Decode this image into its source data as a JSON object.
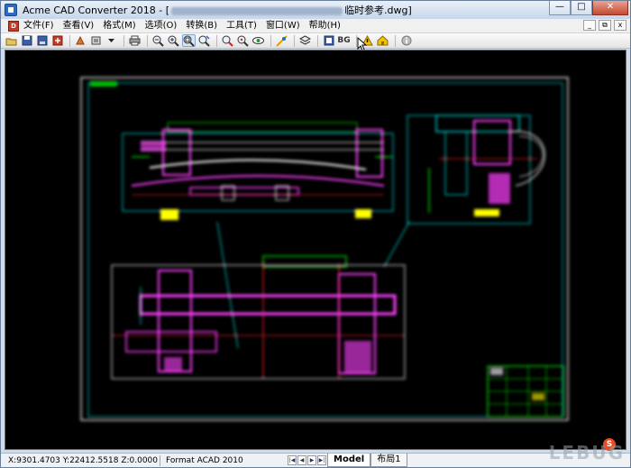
{
  "window": {
    "title_prefix": "Acme CAD Converter 2018 - [",
    "title_suffix": "临时参考.dwg]"
  },
  "menu": {
    "items": [
      "文件(F)",
      "查看(V)",
      "格式(M)",
      "选项(O)",
      "转换(B)",
      "工具(T)",
      "窗口(W)",
      "帮助(H)"
    ]
  },
  "toolbar": {
    "bg_label": "BG",
    "buttons": [
      "open-icon",
      "save-icon",
      "save-all-icon",
      "convert-icon",
      "batch-icon",
      "layer-icon",
      "print-icon",
      "zoom-out-icon",
      "zoom-in-icon",
      "zoom-window-icon",
      "zoom-realtime-icon",
      "pan-icon",
      "zoom-extents-icon",
      "view-icon",
      "measure-icon",
      "layers-icon",
      "bg-toggle",
      "warning-icon",
      "home-icon",
      "info-icon"
    ]
  },
  "status": {
    "coords": "X:9301.4703 Y:22412.5518 Z:0.0000",
    "format": "Format ACAD 2010"
  },
  "tabs": {
    "model": "Model",
    "layout1": "布局1"
  },
  "watermark": {
    "text": "LEBUG",
    "badge": "S"
  },
  "colors": {
    "canvas_bg": "#000000",
    "magenta": "#ff00ff",
    "green": "#00c000",
    "cyan": "#00d0d0",
    "yellow": "#ffff00",
    "red": "#ff2020",
    "white": "#e8e8e8"
  }
}
